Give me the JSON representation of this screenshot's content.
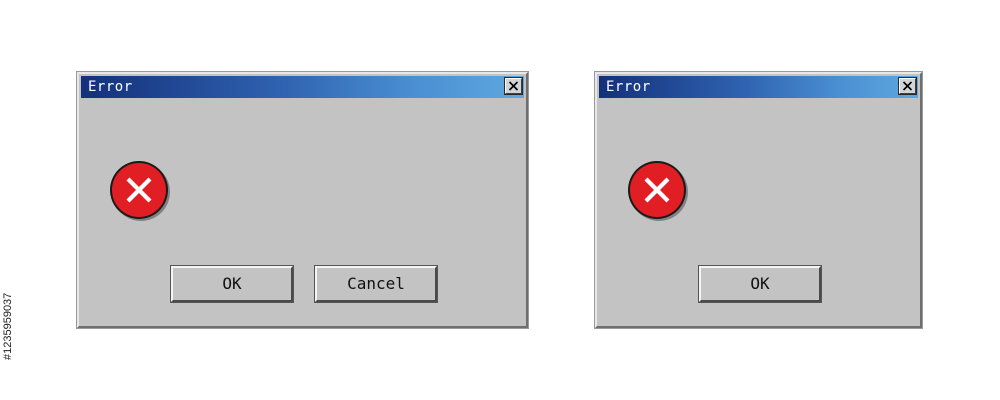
{
  "dialogs": [
    {
      "title": "Error",
      "close_icon": "close-x-icon",
      "icon": "error-circle-x-icon",
      "buttons": [
        "OK",
        "Cancel"
      ]
    },
    {
      "title": "Error",
      "close_icon": "close-x-icon",
      "icon": "error-circle-x-icon",
      "buttons": [
        "OK"
      ]
    }
  ],
  "colors": {
    "titlebar_start": "#14307a",
    "titlebar_end": "#5fa8e0",
    "dialog_face": "#c3c3c3",
    "error_red": "#e01e24"
  },
  "side_credit": "#1235959037"
}
